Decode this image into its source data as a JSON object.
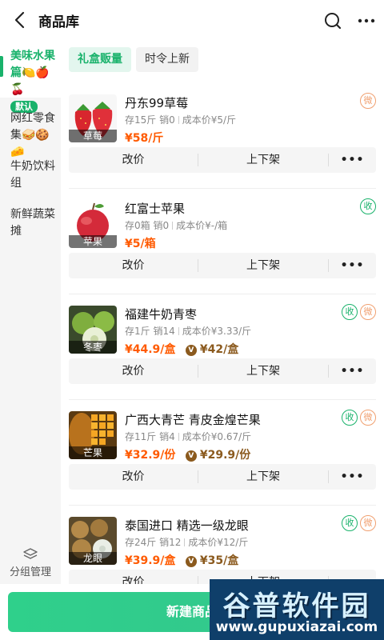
{
  "header": {
    "title": "商品库",
    "back_icon": "chevron-left-icon",
    "search_icon": "search-icon",
    "more_icon": "more-icon"
  },
  "sidebar": {
    "items": [
      {
        "label": "美味水果篇🍋🍎🍒",
        "badge": "默认",
        "active": true
      },
      {
        "label": "网红零食集🥪🍪🧀",
        "active": false
      },
      {
        "label": "牛奶饮料组",
        "active": false
      },
      {
        "label": "新鲜蔬菜摊",
        "active": false
      }
    ],
    "group_manage": "分组管理"
  },
  "tabs": [
    {
      "label": "礼盒贩量",
      "active": true
    },
    {
      "label": "时令上新",
      "active": false
    }
  ],
  "actions": {
    "edit_price": "改价",
    "shelf": "上下架",
    "more": "•••"
  },
  "products": [
    {
      "name": "丹东99草莓",
      "tag": "草莓",
      "stock": "存15斤",
      "sold": "销0",
      "cost": "成本价¥5/斤",
      "price": "¥58/斤",
      "vip_price": "",
      "badges": [
        "微"
      ]
    },
    {
      "name": "红富士苹果",
      "tag": "苹果",
      "stock": "存0箱",
      "sold": "销0",
      "cost": "成本价¥-/箱",
      "price": "¥5/箱",
      "vip_price": "",
      "badges": [
        "收"
      ]
    },
    {
      "name": "福建牛奶青枣",
      "tag": "冬枣",
      "stock": "存1斤",
      "sold": "销14",
      "cost": "成本价¥3.33/斤",
      "price": "¥44.9/盒",
      "vip_price": "¥42/盒",
      "badges": [
        "收",
        "微"
      ]
    },
    {
      "name": "广西大青芒 青皮金煌芒果",
      "tag": "芒果",
      "stock": "存11斤",
      "sold": "销4",
      "cost": "成本价¥0.67/斤",
      "price": "¥32.9/份",
      "vip_price": "¥29.9/份",
      "badges": [
        "收",
        "微"
      ]
    },
    {
      "name": "泰国进口 精选一级龙眼",
      "tag": "龙眼",
      "stock": "存24斤",
      "sold": "销12",
      "cost": "成本价¥12/斤",
      "price": "¥39.9/盒",
      "vip_price": "¥35/盒",
      "badges": [
        "收",
        "微"
      ]
    }
  ],
  "bottom": {
    "new_product": "新建商品"
  },
  "watermark": {
    "title": "谷普软件园",
    "url": "www.gupuxiazai.com"
  },
  "colors": {
    "accent": "#19b26b",
    "price": "#ff5a00",
    "vip": "#8b5a1e",
    "badge_wei": "#f0a070"
  }
}
